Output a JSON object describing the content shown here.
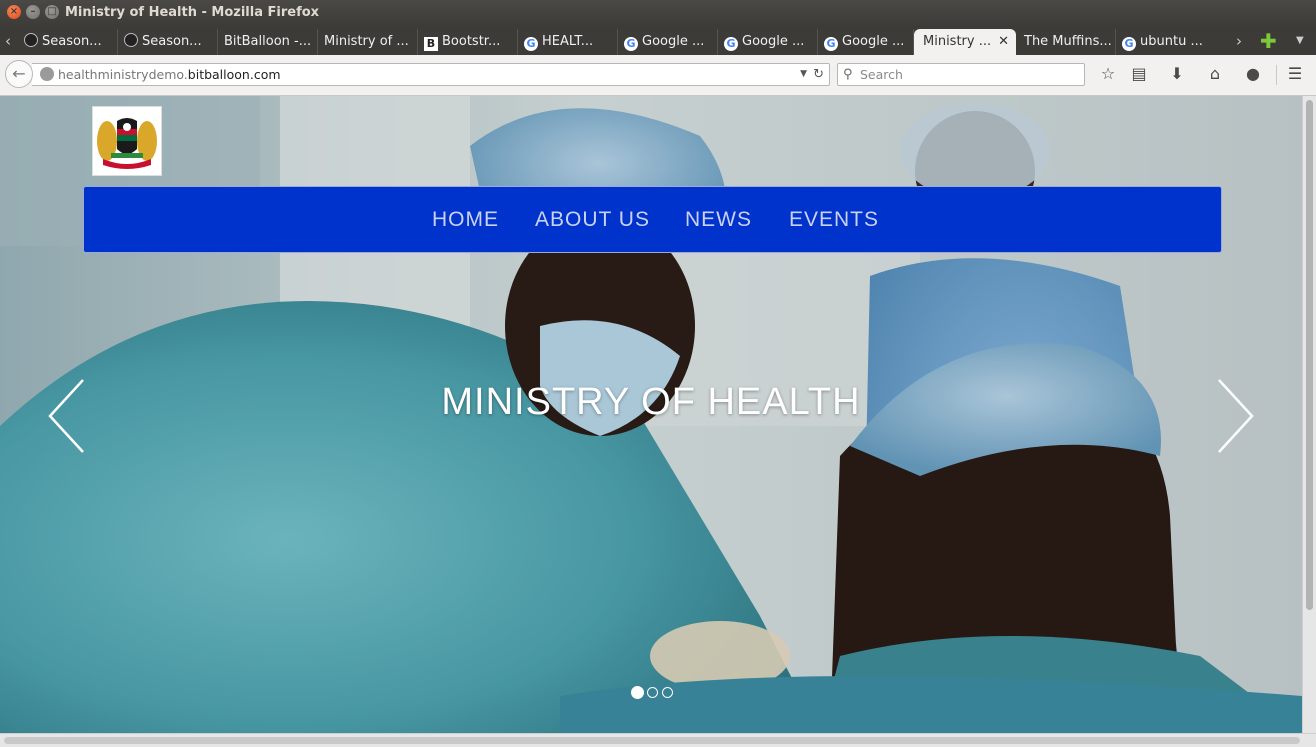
{
  "window": {
    "title": "Ministry of Health - Mozilla Firefox"
  },
  "tabs": [
    {
      "label": "Season...",
      "favicon": "github-icon"
    },
    {
      "label": "Season...",
      "favicon": "github-icon"
    },
    {
      "label": "BitBalloon -...",
      "favicon": "none"
    },
    {
      "label": "Ministry of ...",
      "favicon": "none"
    },
    {
      "label": "Bootstr...",
      "favicon": "bootstrap-icon"
    },
    {
      "label": "HEALT...",
      "favicon": "google-icon"
    },
    {
      "label": "Google ...",
      "favicon": "google-icon"
    },
    {
      "label": "Google ...",
      "favicon": "google-icon"
    },
    {
      "label": "Google ...",
      "favicon": "google-icon"
    },
    {
      "label": "Ministry ...",
      "favicon": "none",
      "active": true
    },
    {
      "label": "The Muffins...",
      "favicon": "none"
    },
    {
      "label": "ubuntu ...",
      "favicon": "google-icon"
    }
  ],
  "navbar": {
    "url_prefix": "healthministrydemo.",
    "url_domain": "bitballoon.com",
    "search_placeholder": "Search"
  },
  "site": {
    "nav": [
      "HOME",
      "ABOUT US",
      "NEWS",
      "EVENTS"
    ],
    "hero_title": "MINISTRY OF HEALTH",
    "carousel_slides": 3,
    "active_slide": 1
  },
  "colors": {
    "nav_bar": "#0032cc",
    "nav_text": "#c9d2ee",
    "tab_strip": "#3c3b37"
  }
}
